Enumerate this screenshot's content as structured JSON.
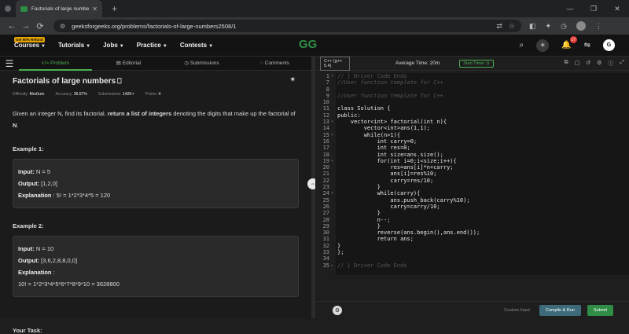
{
  "browser": {
    "tab_title": "Factorials of large numbers | Pra",
    "url": "geeksforgeeks.org/problems/factorials-of-large-numbers2508/1"
  },
  "header": {
    "refund_badge": "Get 90% Refund",
    "menus": [
      "Courses",
      "Tutorials",
      "Jobs",
      "Practice",
      "Contests"
    ],
    "logo": "GG",
    "notifications": "17",
    "user_initial": "G"
  },
  "left_tabs": [
    "Problem",
    "Editorial",
    "Submissions",
    "Comments"
  ],
  "problem": {
    "title": "Factorials of large numbers",
    "difficulty_label": "Difficulty:",
    "difficulty": "Medium",
    "accuracy_label": "Accuracy:",
    "accuracy": "36.57%",
    "submissions_label": "Submissions:",
    "submissions": "142K+",
    "points_label": "Points:",
    "points": "4",
    "desc_1": "Given an integer N, find its factorial. ",
    "desc_bold": "return a list of integers",
    "desc_2": " denoting the digits that make up the factorial of ",
    "desc_n": "N",
    "desc_end": ".",
    "example1_label": "Example 1:",
    "example1": {
      "input_label": "Input:",
      "input": "N = 5",
      "output_label": "Output:",
      "output": "[1,2,0]",
      "expl_label": "Explanation",
      "expl": ": 5! = 1*2*3*4*5 = 120"
    },
    "example2_label": "Example 2:",
    "example2": {
      "input_label": "Input:",
      "input": "N = 10",
      "output_label": "Output:",
      "output": "[3,6,2,8,8,0,0]",
      "expl_label": "Explanation",
      "expl_colon": ":",
      "expl": "10! = 1*2*3*4*5*6*7*8*9*10 = 3628800"
    },
    "your_task": "Your Task:"
  },
  "editor": {
    "language": "C++ (g++ 5.4)",
    "avg_time": "Average Time: 20m",
    "start_timer": "Start Timer",
    "custom_input": "Custom Input",
    "compile_run": "Compile & Run",
    "submit": "Submit",
    "lines": [
      {
        "n": "1",
        "t": "// } Driver Code Ends",
        "k": "hl",
        "f": "▾"
      },
      {
        "n": "7",
        "t": "//User function template for C++",
        "k": "cmt",
        "f": ""
      },
      {
        "n": "8",
        "t": "",
        "k": "norm",
        "f": ""
      },
      {
        "n": "9",
        "t": "//User function template for C++",
        "k": "cmt",
        "f": ""
      },
      {
        "n": "10",
        "t": "",
        "k": "norm",
        "f": ""
      },
      {
        "n": "11",
        "t": "class Solution {",
        "k": "norm",
        "f": ""
      },
      {
        "n": "12",
        "t": "public:",
        "k": "norm",
        "f": ""
      },
      {
        "n": "13",
        "t": "    vector<int> factorial(int n){",
        "k": "norm",
        "f": "▾"
      },
      {
        "n": "14",
        "t": "        vector<int>ans(1,1);",
        "k": "norm",
        "f": ""
      },
      {
        "n": "15",
        "t": "        while(n>1){",
        "k": "norm",
        "f": "▾"
      },
      {
        "n": "16",
        "t": "            int carry=0;",
        "k": "norm",
        "f": ""
      },
      {
        "n": "17",
        "t": "            int res=0;",
        "k": "norm",
        "f": ""
      },
      {
        "n": "18",
        "t": "            int size=ans.size();",
        "k": "norm",
        "f": ""
      },
      {
        "n": "19",
        "t": "            for(int i=0;i<size;i++){",
        "k": "norm",
        "f": "▾"
      },
      {
        "n": "20",
        "t": "                res=ans[i]*n+carry;",
        "k": "norm",
        "f": ""
      },
      {
        "n": "21",
        "t": "                ans[i]=res%10;",
        "k": "norm",
        "f": ""
      },
      {
        "n": "22",
        "t": "                carry=res/10;",
        "k": "norm",
        "f": ""
      },
      {
        "n": "23",
        "t": "            }",
        "k": "norm",
        "f": ""
      },
      {
        "n": "24",
        "t": "            while(carry){",
        "k": "norm",
        "f": "▾"
      },
      {
        "n": "25",
        "t": "                ans.push_back(carry%10);",
        "k": "norm",
        "f": ""
      },
      {
        "n": "26",
        "t": "                carry=carry/10;",
        "k": "norm",
        "f": ""
      },
      {
        "n": "27",
        "t": "            }",
        "k": "norm",
        "f": ""
      },
      {
        "n": "28",
        "t": "            n--;",
        "k": "norm",
        "f": ""
      },
      {
        "n": "29",
        "t": "            }",
        "k": "norm",
        "f": ""
      },
      {
        "n": "30",
        "t": "            reverse(ans.begin(),ans.end());",
        "k": "norm",
        "f": ""
      },
      {
        "n": "31",
        "t": "            return ans;",
        "k": "norm",
        "f": ""
      },
      {
        "n": "32",
        "t": "}",
        "k": "norm",
        "f": ""
      },
      {
        "n": "33",
        "t": "};",
        "k": "norm",
        "f": ""
      },
      {
        "n": "34",
        "t": "",
        "k": "norm",
        "f": ""
      },
      {
        "n": "35",
        "t": "// } Driver Code Ends",
        "k": "hl",
        "f": "▸"
      }
    ]
  }
}
